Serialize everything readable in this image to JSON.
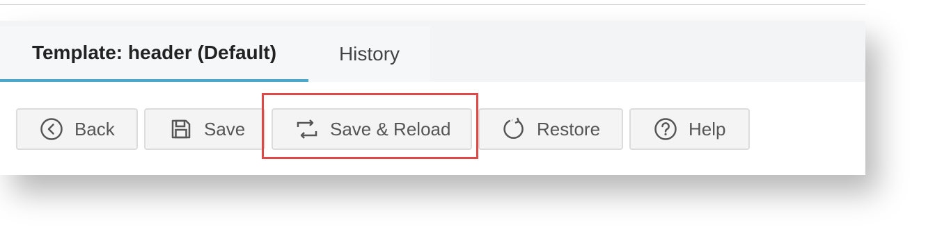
{
  "tabs": {
    "active_label": "Template: header (Default)",
    "history_label": "History"
  },
  "toolbar": {
    "back_label": "Back",
    "save_label": "Save",
    "save_reload_label": "Save & Reload",
    "restore_label": "Restore",
    "help_label": "Help"
  },
  "icons": {
    "back": "chevron-left-circle-icon",
    "save": "floppy-disk-icon",
    "save_reload": "reload-arrows-icon",
    "restore": "restore-arrow-icon",
    "help": "question-circle-icon"
  },
  "colors": {
    "tab_active_underline": "#4aa9c9",
    "highlight_border": "#e04848",
    "tabbar_background": "#f3f4f5",
    "button_background": "#f4f4f4",
    "button_border": "#dcdcdc",
    "text_primary": "#222222",
    "text_secondary": "#555555"
  }
}
